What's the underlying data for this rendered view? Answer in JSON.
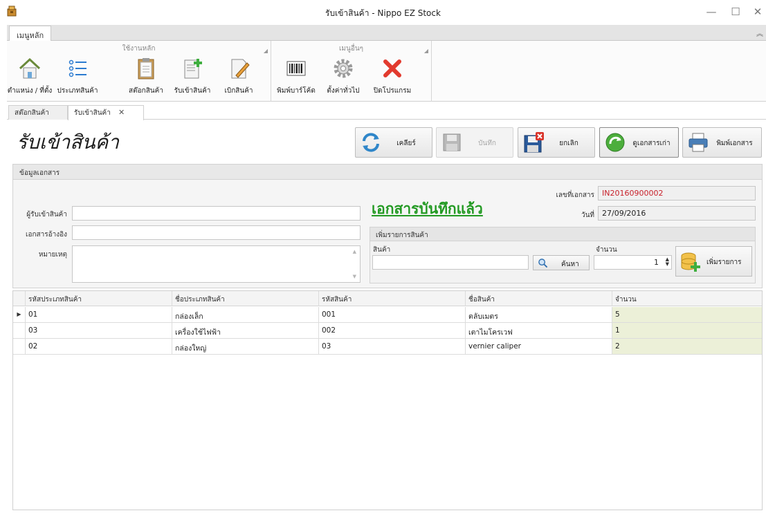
{
  "window": {
    "title": "รับเข้าสินค้า - Nippo EZ Stock",
    "minimize": "—",
    "maximize": "☐",
    "close": "✕"
  },
  "ribbon": {
    "tab_label": "เมนูหลัก",
    "collapse_glyph": "︽",
    "groups": [
      {
        "caption": "ใช้งานหลัก",
        "buttons": [
          {
            "label": "ตำแหน่ง / ที่ตั้ง",
            "icon": "home-icon"
          },
          {
            "label": "ประเภทสินค้า",
            "icon": "list-icon"
          },
          {
            "label": "สต๊อกสินค้า",
            "icon": "clipboard-icon"
          },
          {
            "label": "รับเข้าสินค้า",
            "icon": "document-add-icon"
          },
          {
            "label": "เบิกสินค้า",
            "icon": "document-edit-icon"
          }
        ]
      },
      {
        "caption": "เมนูอื่นๆ",
        "buttons": [
          {
            "label": "พิมพ์บาร์โค้ด",
            "icon": "barcode-icon"
          },
          {
            "label": "ตั้งค่าทั่วไป",
            "icon": "gear-icon"
          },
          {
            "label": "ปิดโปรแกรม",
            "icon": "close-x-icon"
          }
        ]
      }
    ]
  },
  "doc_tabs": [
    {
      "label": "สต๊อกสินค้า",
      "active": false
    },
    {
      "label": "รับเข้าสินค้า",
      "active": true,
      "close": "✕"
    }
  ],
  "page_title": "รับเข้าสินค้า",
  "toolbar": {
    "clear": {
      "label": "เคลียร์",
      "icon": "refresh-icon"
    },
    "save": {
      "label": "บันทึก",
      "icon": "save-icon",
      "disabled": true
    },
    "cancel": {
      "label": "ยกเลิก",
      "icon": "save-cancel-icon"
    },
    "view_old": {
      "label": "ดูเอกสารเก่า",
      "icon": "green-arrow-icon"
    },
    "print": {
      "label": "พิมพ์เอกสาร",
      "icon": "printer-icon"
    }
  },
  "doc_panel": {
    "header": "ข้อมูลเอกสาร",
    "receiver_label": "ผู้รับเข้าสินค้า",
    "receiver_value": "",
    "reference_label": "เอกสารอ้างอิง",
    "reference_value": "",
    "note_label": "หมายเหตุ",
    "note_value": "",
    "saved_banner": "เอกสารบันทึกแล้ว",
    "doc_no_label": "เลขที่เอกสาร",
    "doc_no_value": "IN20160900002",
    "date_label": "วันที่",
    "date_value": "27/09/2016"
  },
  "add_item": {
    "header": "เพิ่มรายการสินค้า",
    "product_label": "สินค้า",
    "product_value": "",
    "search_label": "ค้นหา",
    "qty_label": "จำนวน",
    "qty_value": "1",
    "add_label": "เพิ่มรายการ"
  },
  "grid": {
    "columns": [
      "รหัสประเภทสินค้า",
      "ชื่อประเภทสินค้า",
      "รหัสสินค้า",
      "ชื่อสินค้า",
      "จำนวน"
    ],
    "rows": [
      [
        "01",
        "กล่องเล็ก",
        "001",
        "ตลับเมตร",
        "5"
      ],
      [
        "03",
        "เครื่องใช้ไฟฟ้า",
        "002",
        "เตาไมโครเวฟ",
        "1"
      ],
      [
        "02",
        "กล่องใหญ่",
        "03",
        "vernier caliper",
        "2"
      ]
    ],
    "current_row_marker": "▶"
  },
  "colors": {
    "banner_green": "#239a23",
    "doc_no_red": "#c8202a",
    "qty_cell_bg": "#ecf0d8"
  }
}
